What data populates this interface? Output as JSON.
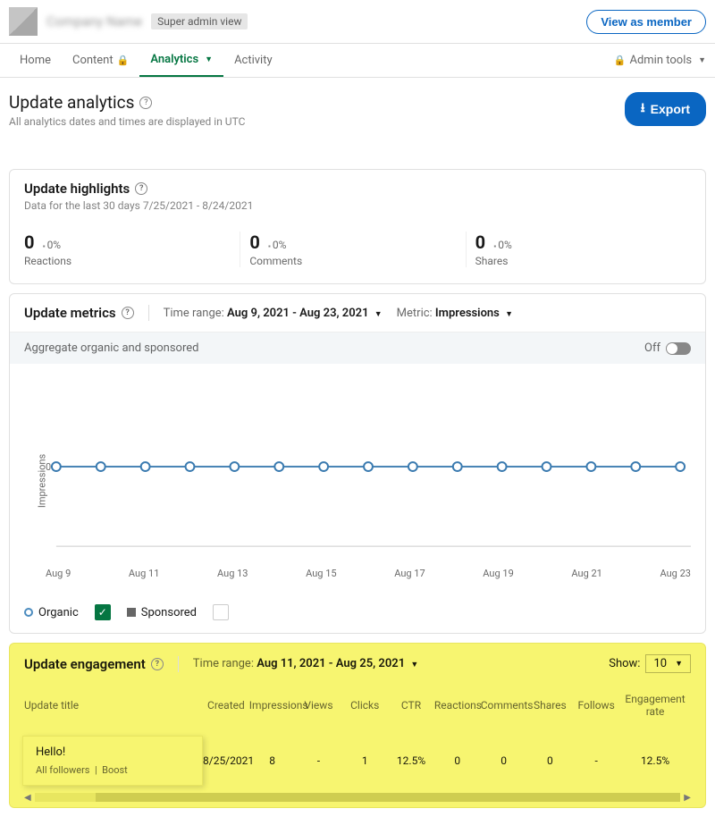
{
  "header": {
    "org_name": "Company Name",
    "admin_badge": "Super admin view",
    "view_member": "View as member"
  },
  "tabs": {
    "home": "Home",
    "content": "Content",
    "analytics": "Analytics",
    "activity": "Activity",
    "admin_tools": "Admin tools"
  },
  "page": {
    "title": "Update analytics",
    "subtitle": "All analytics dates and times are displayed in UTC",
    "export": "Export"
  },
  "highlights": {
    "title": "Update highlights",
    "range": "Data for the last 30 days 7/25/2021 - 8/24/2021",
    "stats": [
      {
        "value": "0",
        "delta": "0%",
        "label": "Reactions"
      },
      {
        "value": "0",
        "delta": "0%",
        "label": "Comments"
      },
      {
        "value": "0",
        "delta": "0%",
        "label": "Shares"
      }
    ]
  },
  "metrics": {
    "title": "Update metrics",
    "time_label": "Time range:",
    "time_value": "Aug 9, 2021 - Aug 23, 2021",
    "metric_label": "Metric:",
    "metric_value": "Impressions",
    "agg_label": "Aggregate organic and sponsored",
    "agg_state": "Off",
    "y_label": "Impressions",
    "legend_organic": "Organic",
    "legend_sponsored": "Sponsored"
  },
  "engagement": {
    "title": "Update engagement",
    "time_label": "Time range:",
    "time_value": "Aug 11, 2021 - Aug 25, 2021",
    "show_label": "Show:",
    "show_value": "10",
    "columns": [
      "Update title",
      "Created",
      "Impressions",
      "Views",
      "Clicks",
      "CTR",
      "Reactions",
      "Comments",
      "Shares",
      "Follows",
      "Engagement rate"
    ],
    "row": {
      "title": "Hello!",
      "sub": "All followers",
      "boost": "Boost",
      "created": "8/25/2021",
      "impressions": "8",
      "views": "-",
      "clicks": "1",
      "ctr": "12.5%",
      "reactions": "0",
      "comments": "0",
      "shares": "0",
      "follows": "-",
      "er": "12.5%"
    }
  },
  "chart_data": {
    "type": "line",
    "title": "",
    "xlabel": "",
    "ylabel": "Impressions",
    "ylim": [
      0,
      0
    ],
    "x_ticks": [
      "Aug 9",
      "Aug 11",
      "Aug 13",
      "Aug 15",
      "Aug 17",
      "Aug 19",
      "Aug 21",
      "Aug 23"
    ],
    "categories": [
      "Aug 9",
      "Aug 10",
      "Aug 11",
      "Aug 12",
      "Aug 13",
      "Aug 14",
      "Aug 15",
      "Aug 16",
      "Aug 17",
      "Aug 18",
      "Aug 19",
      "Aug 20",
      "Aug 21",
      "Aug 22",
      "Aug 23"
    ],
    "series": [
      {
        "name": "Organic",
        "values": [
          0,
          0,
          0,
          0,
          0,
          0,
          0,
          0,
          0,
          0,
          0,
          0,
          0,
          0,
          0
        ]
      }
    ]
  }
}
